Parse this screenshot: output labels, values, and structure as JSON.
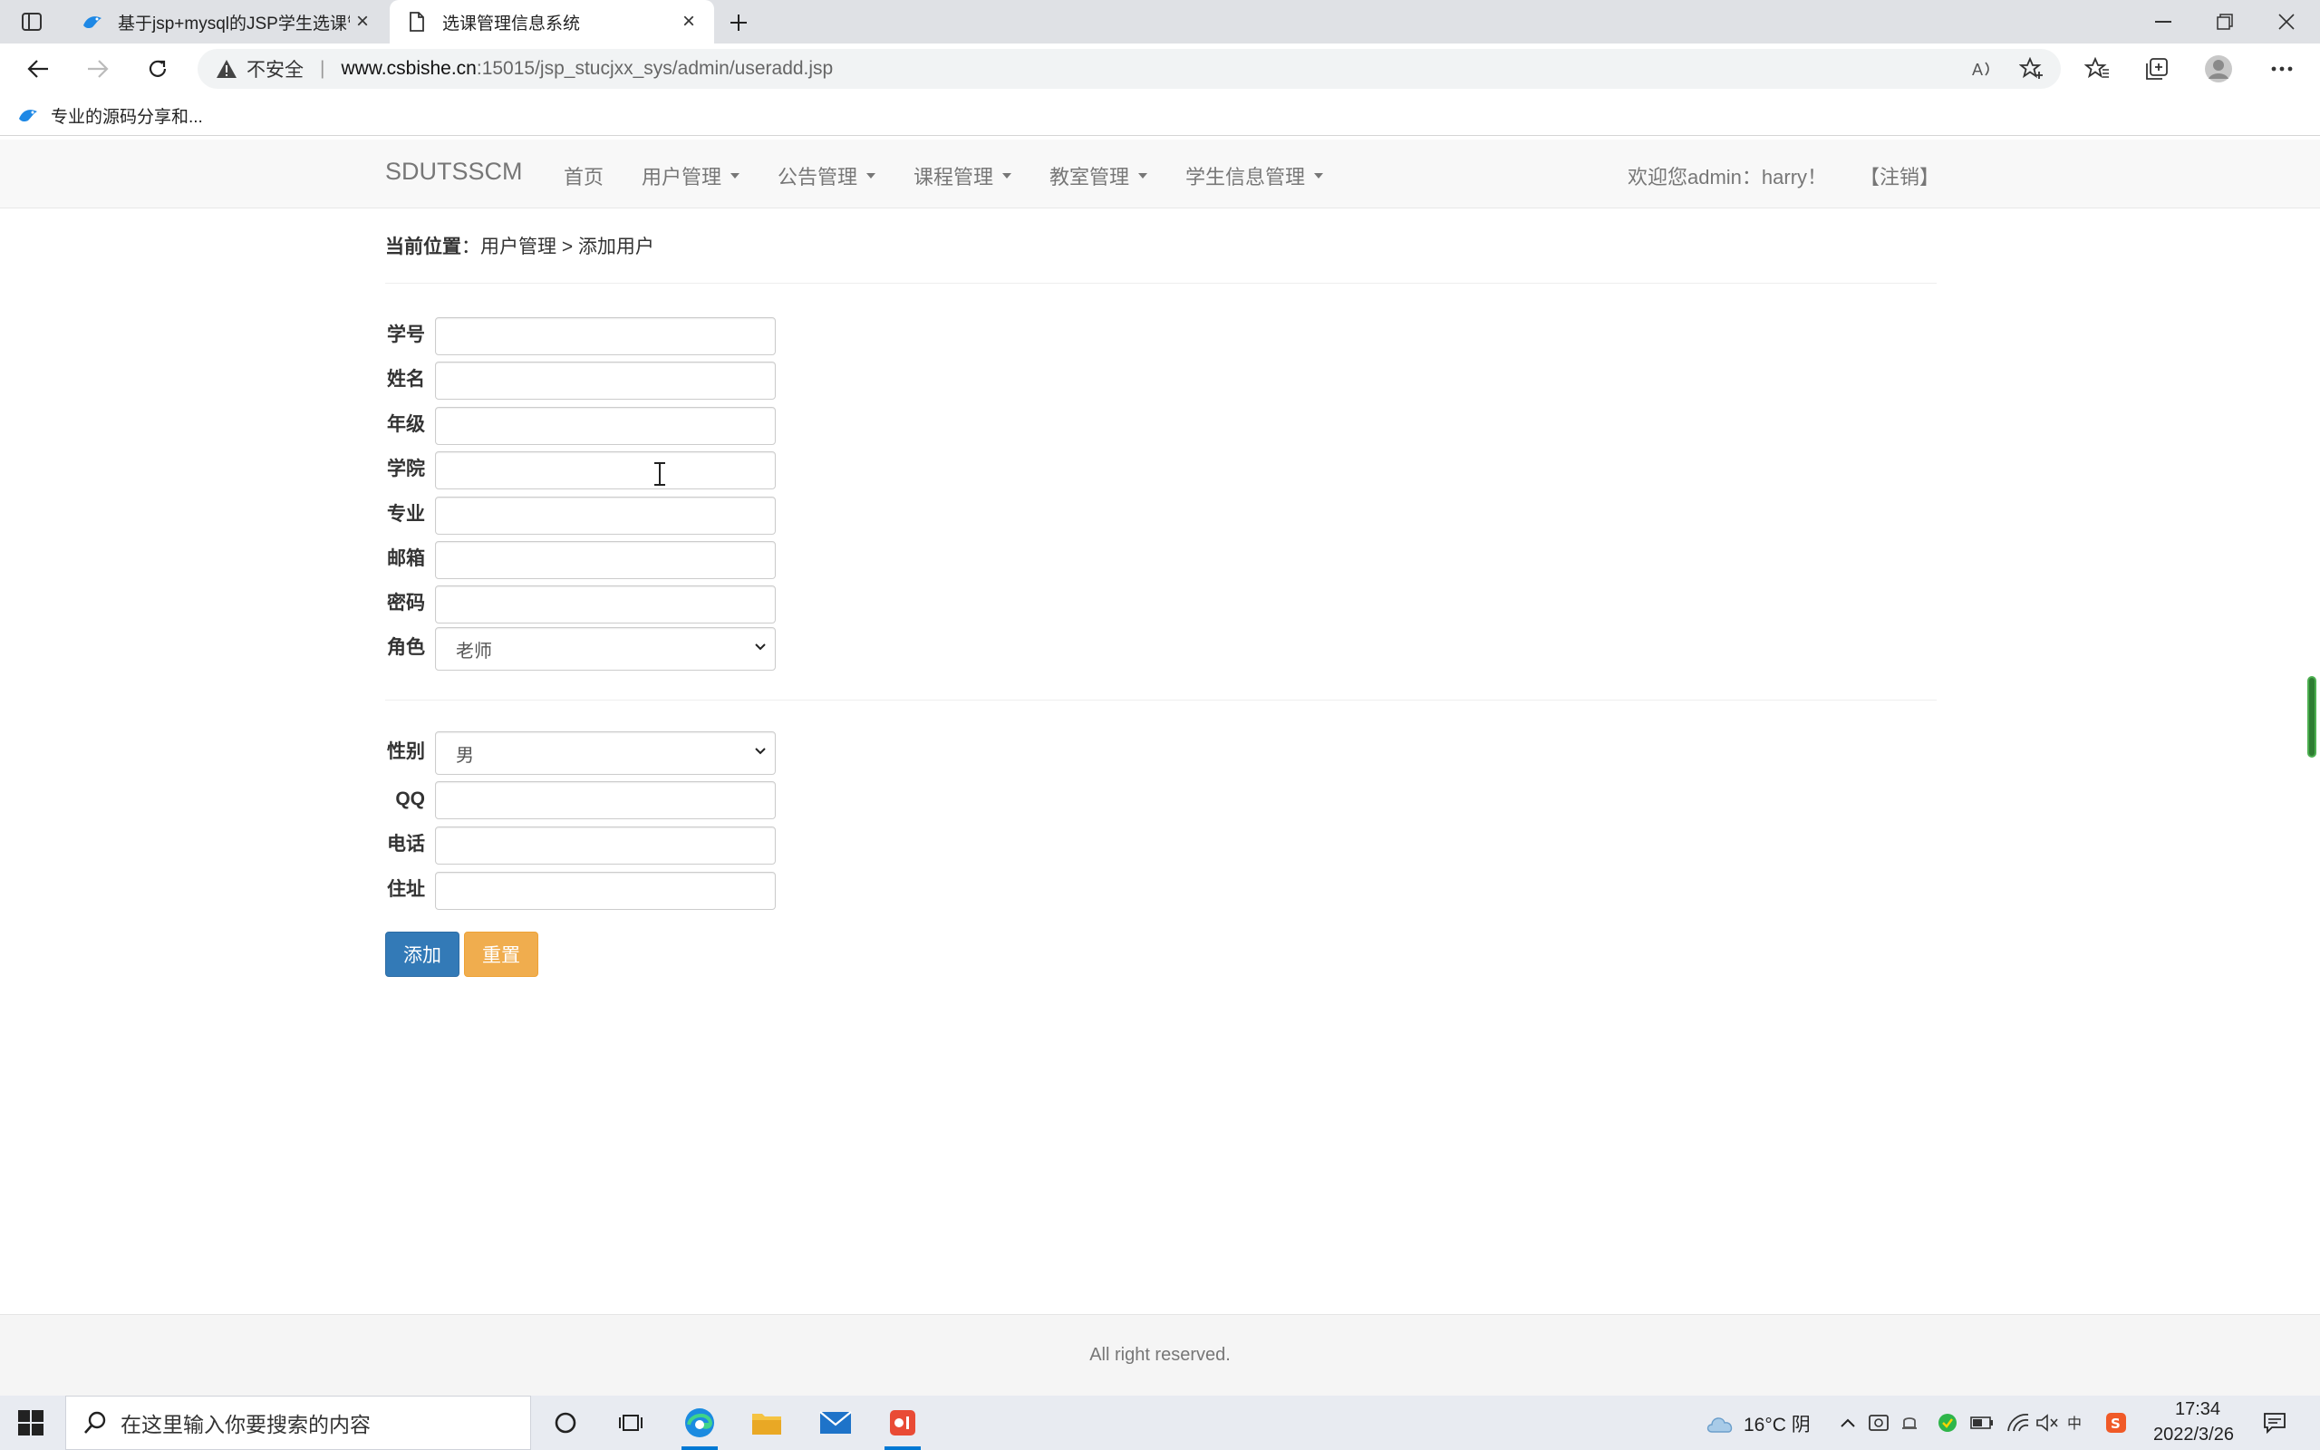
{
  "browser": {
    "tabs": [
      {
        "title": "基于jsp+mysql的JSP学生选课管"
      },
      {
        "title": "选课管理信息系统"
      }
    ],
    "address": {
      "insecure_label": "不安全",
      "separator": "|",
      "url_host": "www.csbishe.cn",
      "url_path": ":15015/jsp_stucjxx_sys/admin/useradd.jsp"
    },
    "favorites": [
      {
        "label": "专业的源码分享和..."
      }
    ]
  },
  "navbar": {
    "brand": "SDUTSSCM",
    "items": [
      {
        "label": "首页",
        "dropdown": false
      },
      {
        "label": "用户管理",
        "dropdown": true
      },
      {
        "label": "公告管理",
        "dropdown": true
      },
      {
        "label": "课程管理",
        "dropdown": true
      },
      {
        "label": "教室管理",
        "dropdown": true
      },
      {
        "label": "学生信息管理",
        "dropdown": true
      }
    ],
    "welcome": "欢迎您admin：harry！",
    "logout": "【注销】"
  },
  "breadcrumb": {
    "prefix": "当前位置",
    "colon": "：",
    "path": "用户管理 > 添加用户"
  },
  "form": {
    "fields": [
      {
        "label": "学号",
        "value": ""
      },
      {
        "label": "姓名",
        "value": ""
      },
      {
        "label": "年级",
        "value": ""
      },
      {
        "label": "学院",
        "value": ""
      },
      {
        "label": "专业",
        "value": ""
      },
      {
        "label": "邮箱",
        "value": ""
      },
      {
        "label": "密码",
        "value": ""
      },
      {
        "label": "角色",
        "value": "老师"
      }
    ],
    "extra_fields": [
      {
        "label": "性别",
        "value": "男"
      },
      {
        "label": "QQ",
        "value": ""
      },
      {
        "label": "电话",
        "value": ""
      },
      {
        "label": "住址",
        "value": ""
      }
    ],
    "add_button": "添加",
    "reset_button": "重置"
  },
  "footer": {
    "text": "All right reserved."
  },
  "taskbar": {
    "search_placeholder": "在这里输入你要搜索的内容",
    "weather": "16°C 阴",
    "time": "17:34",
    "date": "2022/3/26"
  },
  "colors": {
    "primary": "#337ab7",
    "warning": "#f0ad4e",
    "navbar_bg": "#f8f8f8"
  }
}
